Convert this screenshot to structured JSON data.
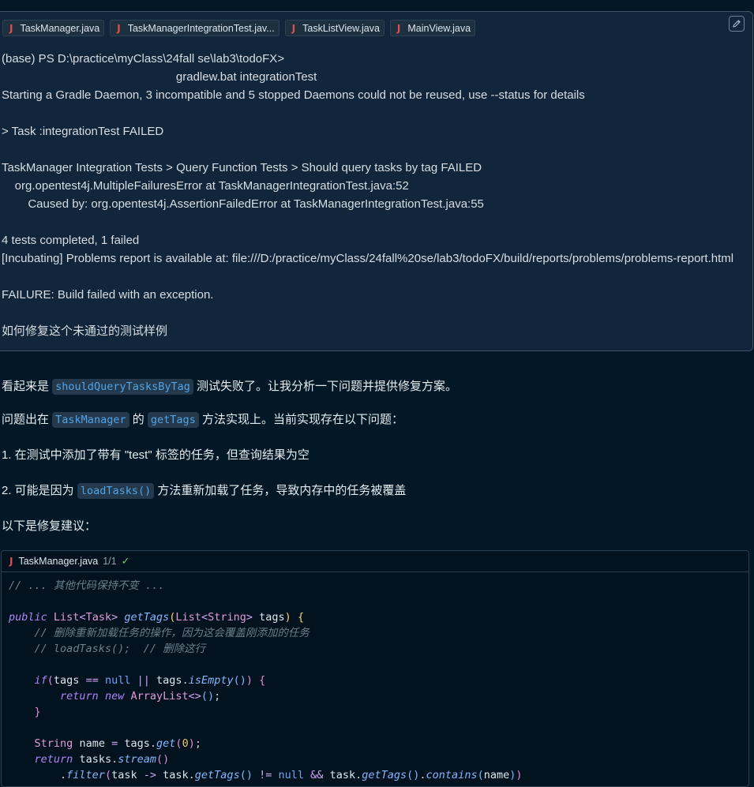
{
  "user_message": {
    "file_chips": [
      {
        "name": "TaskManager.java"
      },
      {
        "name": "TaskManagerIntegrationTest.jav..."
      },
      {
        "name": "TaskListView.java"
      },
      {
        "name": "MainView.java"
      }
    ],
    "terminal_lines": [
      "(base) PS D:\\practice\\myClass\\24fall se\\lab3\\todoFX>",
      "                                                     gradlew.bat integrationTest",
      "Starting a Gradle Daemon, 3 incompatible and 5 stopped Daemons could not be reused, use --status for details",
      "",
      "> Task :integrationTest FAILED",
      "",
      "TaskManager Integration Tests > Query Function Tests > Should query tasks by tag FAILED",
      "    org.opentest4j.MultipleFailuresError at TaskManagerIntegrationTest.java:52",
      "        Caused by: org.opentest4j.AssertionFailedError at TaskManagerIntegrationTest.java:55",
      "",
      "4 tests completed, 1 failed"
    ],
    "incubating_line": "[Incubating] Problems report is available at: file:///D:/practice/myClass/24fall%20se/lab3/todoFX/build/reports/problems/problems-report.html",
    "failure_line": "FAILURE: Build failed with an exception.",
    "question": "如何修复这个未通过的测试样例"
  },
  "response": {
    "p1_before": "看起来是 ",
    "p1_code": "shouldQueryTasksByTag",
    "p1_after": " 测试失败了。让我分析一下问题并提供修复方案。",
    "p2_before": "问题出在 ",
    "p2_code1": "TaskManager",
    "p2_middle": " 的 ",
    "p2_code2": "getTags",
    "p2_after": " 方法实现上。当前实现存在以下问题：",
    "item1": "1. 在测试中添加了带有 \"test\" 标签的任务，但查询结果为空",
    "item2_before": "2. 可能是因为 ",
    "item2_code": "loadTasks()",
    "item2_after": " 方法重新加载了任务，导致内存中的任务被覆盖",
    "fix_intro": "以下是修复建议："
  },
  "code_block": {
    "filename": "TaskManager.java",
    "count": "1/1",
    "comment_top": "// ... 其他代码保持不变 ...",
    "comment_1": "// 删除重新加载任务的操作，因为这会覆盖刚添加的任务",
    "comment_2": "// loadTasks();  // 删除这行"
  },
  "colors": {
    "background": "#021826",
    "user_message_bg": "#11263a",
    "inline_code": "#4fa3e8",
    "java_icon": "#e24d4d",
    "check": "#6fcf6f"
  },
  "icons": [
    "edit-icon",
    "java-file-icon",
    "check-icon"
  ]
}
